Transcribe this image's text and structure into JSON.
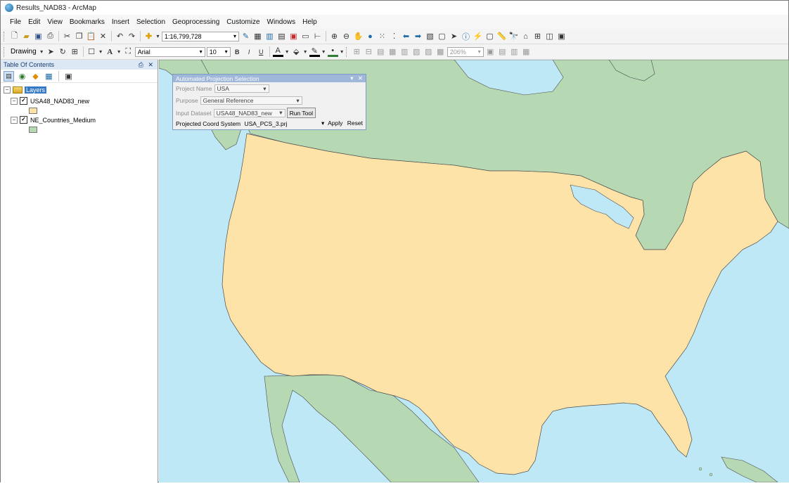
{
  "window": {
    "title": "Results_NAD83 - ArcMap"
  },
  "menu": [
    "File",
    "Edit",
    "View",
    "Bookmarks",
    "Insert",
    "Selection",
    "Geoprocessing",
    "Customize",
    "Windows",
    "Help"
  ],
  "toolbar1": {
    "scale": "1:16,799,728"
  },
  "toolbar2": {
    "drawing_label": "Drawing",
    "font_name": "Arial",
    "font_size": "10",
    "bold": "B",
    "italic": "I",
    "underline": "U",
    "zoom": "206%"
  },
  "toc": {
    "title": "Table Of Contents",
    "pin": "⎙",
    "close": "✕",
    "root": "Layers",
    "layers": [
      {
        "name": "USA48_NAD83_new",
        "checked": true,
        "patch_color": "#fde3a7"
      },
      {
        "name": "NE_Countries_Medium",
        "checked": true,
        "patch_color": "#b6d9b4"
      }
    ]
  },
  "dialog": {
    "title": "Automated Projection Selection",
    "project_name_label": "Project Name",
    "project_name_value": "USA",
    "purpose_label": "Purpose",
    "purpose_value": "General Reference",
    "input_dataset_label": "Input Dataset",
    "input_dataset_value": "USA48_NAD83_new",
    "run_tool": "Run Tool",
    "pcs_label": "Projected Coord System",
    "pcs_value": "USA_PCS_3.prj",
    "apply": "Apply",
    "reset": "Reset"
  },
  "colors": {
    "water": "#bee8f5",
    "usa": "#fde3a7",
    "land": "#b6d9b4",
    "outline": "#4c4c4c"
  },
  "icons": [
    "new-doc-icon",
    "open-icon",
    "save-icon",
    "print-icon",
    "cut-icon",
    "copy-icon",
    "paste-icon",
    "delete-icon",
    "undo-icon",
    "redo-icon",
    "add-data-icon",
    "zoom-in-icon",
    "zoom-out-icon",
    "pan-icon",
    "full-extent-icon",
    "select-icon",
    "identify-icon",
    "find-icon",
    "measure-icon"
  ]
}
